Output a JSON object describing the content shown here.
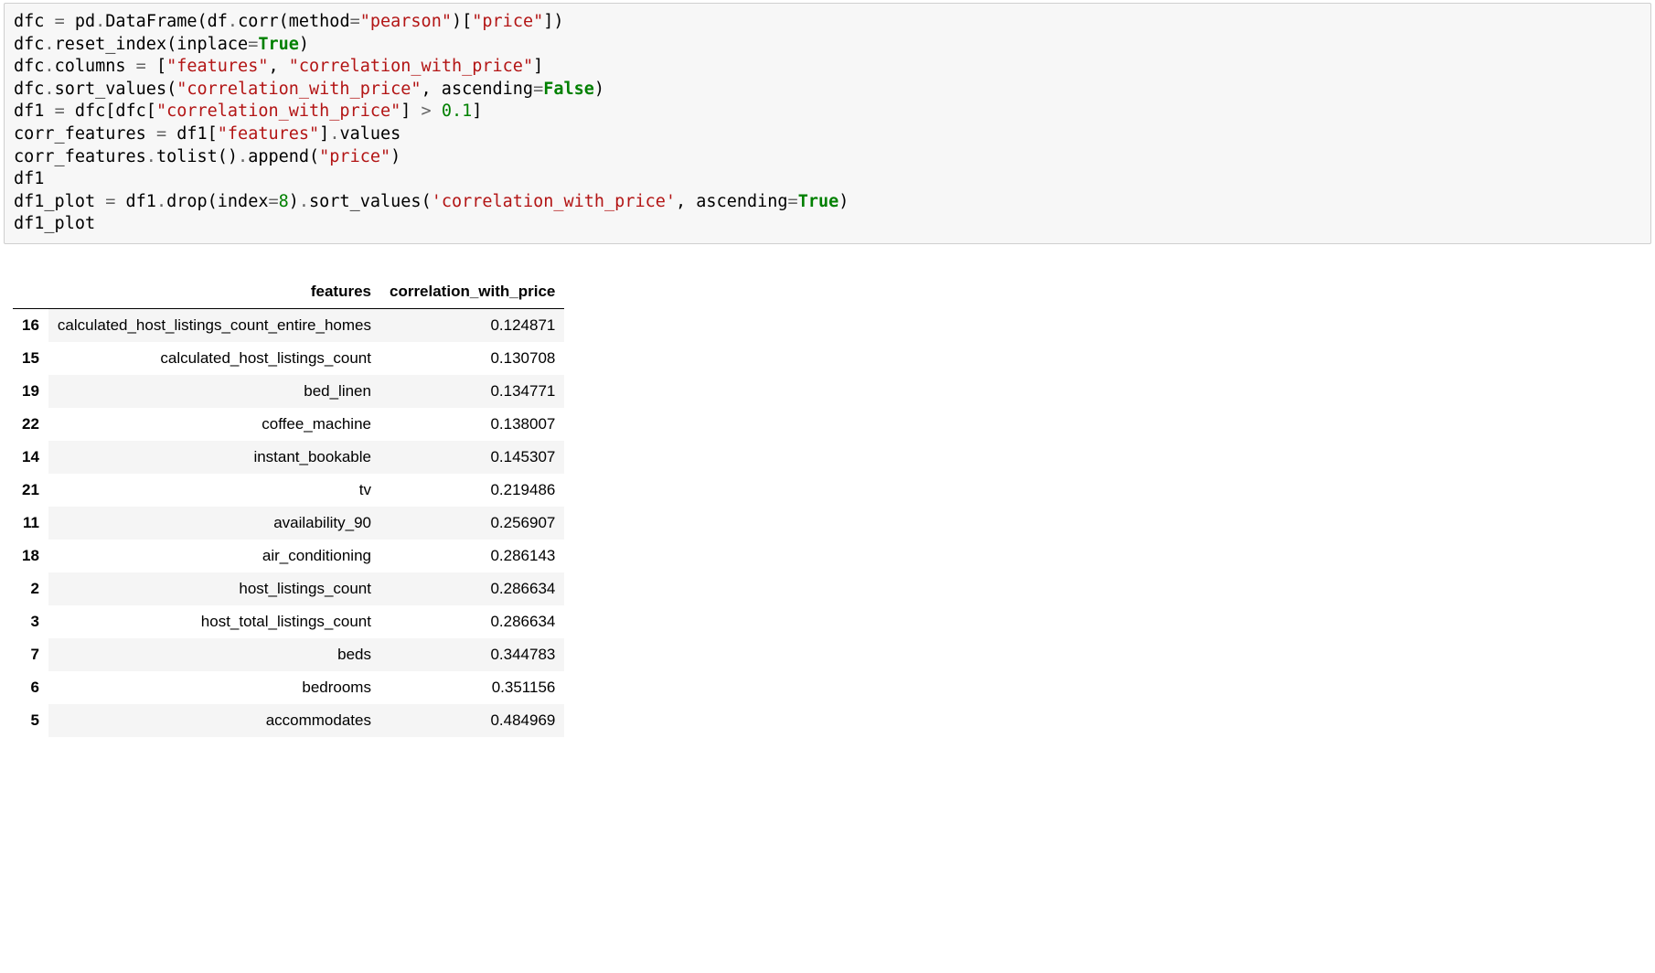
{
  "code": {
    "tokens": [
      [
        [
          "dfc ",
          "name"
        ],
        [
          "=",
          "op"
        ],
        [
          " pd",
          "name"
        ],
        [
          ".",
          "op"
        ],
        [
          "DataFrame(df",
          "name"
        ],
        [
          ".",
          "op"
        ],
        [
          "corr(method",
          "name"
        ],
        [
          "=",
          "op"
        ],
        [
          "\"pearson\"",
          "str"
        ],
        [
          ")[",
          "name"
        ],
        [
          "\"price\"",
          "str"
        ],
        [
          "])",
          "name"
        ]
      ],
      [
        [
          "dfc",
          "name"
        ],
        [
          ".",
          "op"
        ],
        [
          "reset_index(inplace",
          "name"
        ],
        [
          "=",
          "op"
        ],
        [
          "True",
          "kw"
        ],
        [
          ")",
          "name"
        ]
      ],
      [
        [
          "dfc",
          "name"
        ],
        [
          ".",
          "op"
        ],
        [
          "columns ",
          "name"
        ],
        [
          "=",
          "op"
        ],
        [
          " [",
          "name"
        ],
        [
          "\"features\"",
          "str"
        ],
        [
          ", ",
          "name"
        ],
        [
          "\"correlation_with_price\"",
          "str"
        ],
        [
          "]",
          "name"
        ]
      ],
      [
        [
          "dfc",
          "name"
        ],
        [
          ".",
          "op"
        ],
        [
          "sort_values(",
          "name"
        ],
        [
          "\"correlation_with_price\"",
          "str"
        ],
        [
          ", ascending",
          "name"
        ],
        [
          "=",
          "op"
        ],
        [
          "False",
          "kw"
        ],
        [
          ")",
          "name"
        ]
      ],
      [
        [
          "df1 ",
          "name"
        ],
        [
          "=",
          "op"
        ],
        [
          " dfc[dfc[",
          "name"
        ],
        [
          "\"correlation_with_price\"",
          "str"
        ],
        [
          "] ",
          "name"
        ],
        [
          ">",
          "op"
        ],
        [
          " ",
          "name"
        ],
        [
          "0.1",
          "num"
        ],
        [
          "]",
          "name"
        ]
      ],
      [
        [
          "corr_features ",
          "name"
        ],
        [
          "=",
          "op"
        ],
        [
          " df1[",
          "name"
        ],
        [
          "\"features\"",
          "str"
        ],
        [
          "]",
          "name"
        ],
        [
          ".",
          "op"
        ],
        [
          "values",
          "name"
        ]
      ],
      [
        [
          "corr_features",
          "name"
        ],
        [
          ".",
          "op"
        ],
        [
          "tolist()",
          "name"
        ],
        [
          ".",
          "op"
        ],
        [
          "append(",
          "name"
        ],
        [
          "\"price\"",
          "str"
        ],
        [
          ")",
          "name"
        ]
      ],
      [
        [
          "df1",
          "name"
        ]
      ],
      [
        [
          "df1_plot ",
          "name"
        ],
        [
          "=",
          "op"
        ],
        [
          " df1",
          "name"
        ],
        [
          ".",
          "op"
        ],
        [
          "drop(index",
          "name"
        ],
        [
          "=",
          "op"
        ],
        [
          "8",
          "num"
        ],
        [
          ")",
          "name"
        ],
        [
          ".",
          "op"
        ],
        [
          "sort_values(",
          "name"
        ],
        [
          "'correlation_with_price'",
          "str"
        ],
        [
          ", ascending",
          "name"
        ],
        [
          "=",
          "op"
        ],
        [
          "True",
          "kw"
        ],
        [
          ")",
          "name"
        ]
      ],
      [
        [
          "df1_plot",
          "name"
        ]
      ]
    ]
  },
  "table": {
    "columns": [
      "features",
      "correlation_with_price"
    ],
    "rows": [
      {
        "idx": "16",
        "features": "calculated_host_listings_count_entire_homes",
        "corr": "0.124871"
      },
      {
        "idx": "15",
        "features": "calculated_host_listings_count",
        "corr": "0.130708"
      },
      {
        "idx": "19",
        "features": "bed_linen",
        "corr": "0.134771"
      },
      {
        "idx": "22",
        "features": "coffee_machine",
        "corr": "0.138007"
      },
      {
        "idx": "14",
        "features": "instant_bookable",
        "corr": "0.145307"
      },
      {
        "idx": "21",
        "features": "tv",
        "corr": "0.219486"
      },
      {
        "idx": "11",
        "features": "availability_90",
        "corr": "0.256907"
      },
      {
        "idx": "18",
        "features": "air_conditioning",
        "corr": "0.286143"
      },
      {
        "idx": "2",
        "features": "host_listings_count",
        "corr": "0.286634"
      },
      {
        "idx": "3",
        "features": "host_total_listings_count",
        "corr": "0.286634"
      },
      {
        "idx": "7",
        "features": "beds",
        "corr": "0.344783"
      },
      {
        "idx": "6",
        "features": "bedrooms",
        "corr": "0.351156"
      },
      {
        "idx": "5",
        "features": "accommodates",
        "corr": "0.484969"
      }
    ]
  }
}
